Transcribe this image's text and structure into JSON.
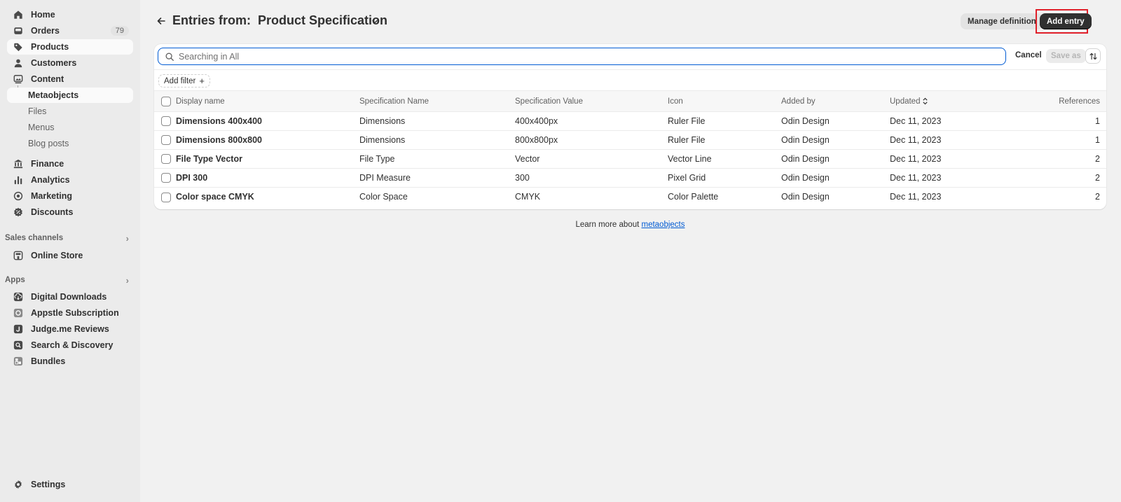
{
  "sidebar": {
    "main_items": [
      {
        "label": "Home",
        "icon": "home-icon"
      },
      {
        "label": "Orders",
        "icon": "orders-icon",
        "badge": "79"
      },
      {
        "label": "Products",
        "icon": "tag-icon"
      },
      {
        "label": "Customers",
        "icon": "person-icon"
      },
      {
        "label": "Content",
        "icon": "content-icon"
      }
    ],
    "content_sub": [
      {
        "label": "Metaobjects"
      },
      {
        "label": "Files"
      },
      {
        "label": "Menus"
      },
      {
        "label": "Blog posts"
      }
    ],
    "main_items_2": [
      {
        "label": "Finance",
        "icon": "bank-icon"
      },
      {
        "label": "Analytics",
        "icon": "chart-icon"
      },
      {
        "label": "Marketing",
        "icon": "target-icon"
      },
      {
        "label": "Discounts",
        "icon": "discount-icon"
      }
    ],
    "sales_channels": {
      "heading": "Sales channels",
      "items": [
        {
          "label": "Online Store"
        }
      ]
    },
    "apps": {
      "heading": "Apps",
      "items": [
        {
          "label": "Digital Downloads"
        },
        {
          "label": "Appstle Subscription"
        },
        {
          "label": "Judge.me Reviews"
        },
        {
          "label": "Search & Discovery"
        },
        {
          "label": "Bundles"
        }
      ]
    },
    "settings_label": "Settings"
  },
  "header": {
    "title": "Entries from:  Product Specification",
    "manage_label": "Manage definition",
    "add_label": "Add entry"
  },
  "toolbar": {
    "search_placeholder": "Searching in All",
    "search_value": "",
    "cancel_label": "Cancel",
    "saveas_label": "Save as",
    "add_filter_label": "Add filter"
  },
  "table": {
    "columns": [
      "Display name",
      "Specification Name",
      "Specification Value",
      "Icon",
      "Added by",
      "Updated",
      "References"
    ],
    "rows": [
      [
        "Dimensions 400x400",
        "Dimensions",
        "400x400px",
        "Ruler File",
        "Odin Design",
        "Dec 11, 2023",
        "1"
      ],
      [
        "Dimensions 800x800",
        "Dimensions",
        "800x800px",
        "Ruler File",
        "Odin Design",
        "Dec 11, 2023",
        "1"
      ],
      [
        "File Type Vector",
        "File Type",
        "Vector",
        "Vector Line",
        "Odin Design",
        "Dec 11, 2023",
        "2"
      ],
      [
        "DPI 300",
        "DPI Measure",
        "300",
        "Pixel Grid",
        "Odin Design",
        "Dec 11, 2023",
        "2"
      ],
      [
        "Color space CMYK",
        "Color Space",
        "CMYK",
        "Color Palette",
        "Odin Design",
        "Dec 11, 2023",
        "2"
      ]
    ]
  },
  "footer": {
    "learn_text": "Learn more about ",
    "learn_link": "metaobjects"
  },
  "colors": {
    "accent": "#005bd3",
    "primary_button": "#303030",
    "highlight": "#e0202a"
  }
}
